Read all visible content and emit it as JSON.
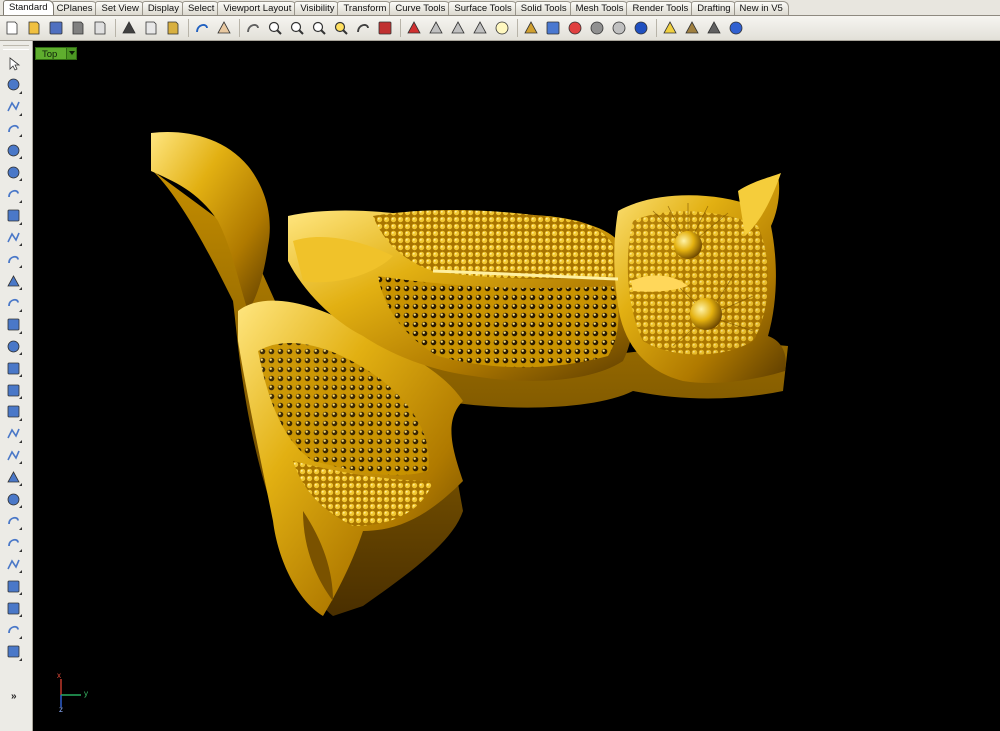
{
  "tabs": [
    {
      "label": "Standard",
      "active": true
    },
    {
      "label": "CPlanes"
    },
    {
      "label": "Set View"
    },
    {
      "label": "Display"
    },
    {
      "label": "Select"
    },
    {
      "label": "Viewport Layout"
    },
    {
      "label": "Visibility"
    },
    {
      "label": "Transform"
    },
    {
      "label": "Curve Tools"
    },
    {
      "label": "Surface Tools"
    },
    {
      "label": "Solid Tools"
    },
    {
      "label": "Mesh Tools"
    },
    {
      "label": "Render Tools"
    },
    {
      "label": "Drafting"
    },
    {
      "label": "New in V5"
    }
  ],
  "toolbar_icons": [
    "new-icon",
    "open-icon",
    "save-icon",
    "print-icon",
    "import-icon",
    "cut-icon",
    "copy-icon",
    "paste-icon",
    "undo-icon",
    "pan-hand-icon",
    "rotate-view-icon",
    "zoom-icon",
    "zoom-window-icon",
    "zoom-extents-icon",
    "zoom-selected-icon",
    "undo-view-icon",
    "four-viewports-icon",
    "car-camera-icon",
    "ghosted-display-icon",
    "analyze-icon",
    "render-preview-icon",
    "light-bulb-icon",
    "lock-icon",
    "layer-icon",
    "color-wheel-icon",
    "render-sphere-icon",
    "material-sphere-icon",
    "environment-sphere-icon",
    "ribbon-icon",
    "options-gear-icon",
    "osnap-icon",
    "help-icon"
  ],
  "sidebar_icons": [
    "select-arrow-icon",
    "point-icon",
    "polyline-icon",
    "curve-icon",
    "circle-icon",
    "ellipse-icon",
    "arc-icon",
    "rectangle-icon",
    "polygon-icon",
    "fillet-icon",
    "surface-edge-icon",
    "sweep-icon",
    "box-solid-icon",
    "sphere-solid-icon",
    "cylinder-solid-icon",
    "extrude-icon",
    "mesh-tools-icon",
    "transform-yellow-icon",
    "dimension-icon",
    "boolean-icon",
    "points-on-icon",
    "rotate-icon",
    "curve-from-object-icon",
    "text-object-icon",
    "array-icon",
    "grid-array-icon",
    "analyze-direction-icon",
    "render-box-icon"
  ],
  "sidebar_more": "»",
  "viewport": {
    "title": "Top",
    "axis_x": "x",
    "axis_y": "y",
    "axis_z": "z"
  },
  "colors": {
    "viewport_bg": "#000000",
    "viewport_tag": "#5fae2e",
    "model_gold": "#d9a400"
  }
}
